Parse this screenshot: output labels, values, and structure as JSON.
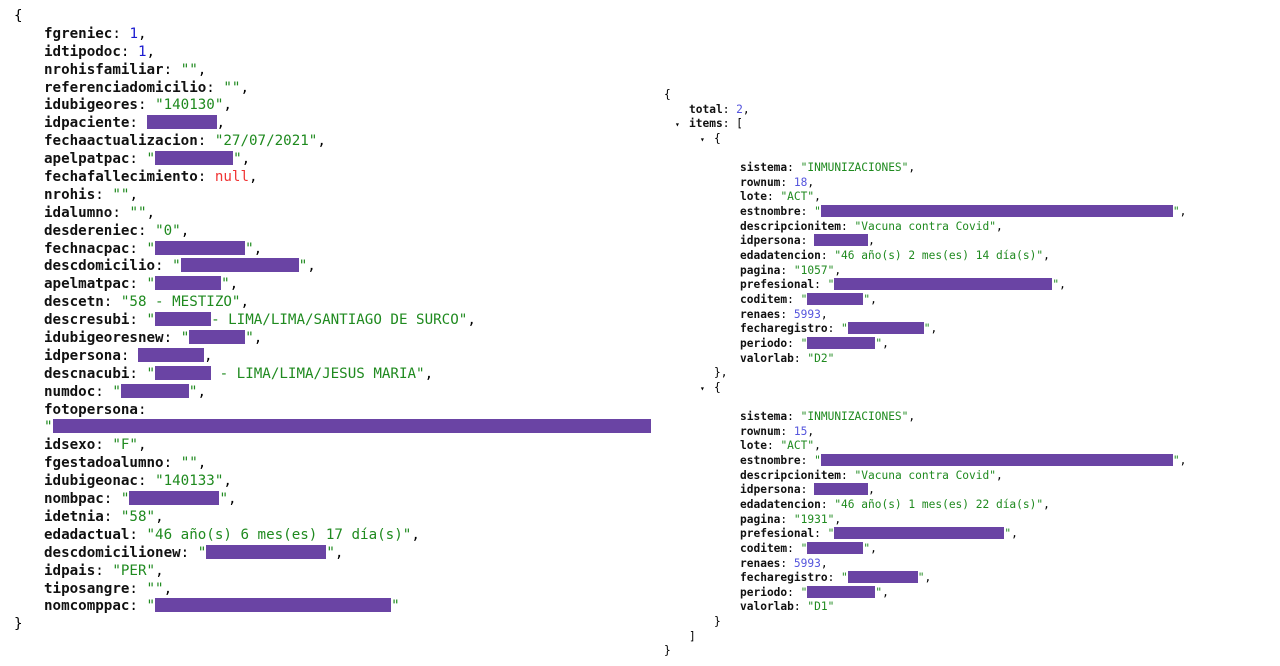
{
  "left": {
    "open": "{",
    "close": "}",
    "fields": [
      {
        "key": "fgreniec",
        "type": "n",
        "value": "1"
      },
      {
        "key": "idtipodoc",
        "type": "n",
        "value": "1"
      },
      {
        "key": "nrohisfamiliar",
        "type": "s",
        "value": "\"\""
      },
      {
        "key": "referenciadomicilio",
        "type": "s",
        "value": "\"\""
      },
      {
        "key": "idubigeores",
        "type": "s",
        "value": "\"140130\""
      },
      {
        "key": "idpaciente",
        "type": "redact"
      },
      {
        "key": "fechaactualizacion",
        "type": "s",
        "value": "\"27/07/2021\""
      },
      {
        "key": "apelpatpac",
        "type": "redact"
      },
      {
        "key": "fechafallecimiento",
        "type": "null",
        "value": "null"
      },
      {
        "key": "nrohis",
        "type": "s",
        "value": "\"\""
      },
      {
        "key": "idalumno",
        "type": "s",
        "value": "\"\""
      },
      {
        "key": "desdereniec",
        "type": "s",
        "value": "\"0\""
      },
      {
        "key": "fechnacpac",
        "type": "redact"
      },
      {
        "key": "descdomicilio",
        "type": "redact"
      },
      {
        "key": "apelmatpac",
        "type": "redact"
      },
      {
        "key": "descetn",
        "type": "s",
        "value": "\"58 - MESTIZO\""
      },
      {
        "key": "descresubi",
        "type": "redact",
        "suffix": "- LIMA/LIMA/SANTIAGO DE SURCO\""
      },
      {
        "key": "idubigeoresnew",
        "type": "redact"
      },
      {
        "key": "idpersona",
        "type": "redact"
      },
      {
        "key": "descnacubi",
        "type": "redact",
        "suffix": " - LIMA/LIMA/JESUS MARIA\""
      },
      {
        "key": "numdoc",
        "type": "redact"
      },
      {
        "key": "fotopersona",
        "type": "redact"
      },
      {
        "key": "idsexo",
        "type": "s",
        "value": "\"F\""
      },
      {
        "key": "fgestadoalumno",
        "type": "s",
        "value": "\"\""
      },
      {
        "key": "idubigeonac",
        "type": "s",
        "value": "\"140133\""
      },
      {
        "key": "nombpac",
        "type": "redact"
      },
      {
        "key": "idetnia",
        "type": "s",
        "value": "\"58\""
      },
      {
        "key": "edadactual",
        "type": "s",
        "value": "\"46 año(s) 6 mes(es) 17 día(s)\""
      },
      {
        "key": "descdomicilionew",
        "type": "redact"
      },
      {
        "key": "idpais",
        "type": "s",
        "value": "\"PER\""
      },
      {
        "key": "tiposangre",
        "type": "s",
        "value": "\"\""
      },
      {
        "key": "nomcomppac",
        "type": "redact"
      }
    ]
  },
  "right": {
    "open": "{",
    "close": "}",
    "total_key": "total",
    "total": "2",
    "items_key": "items",
    "items_open": "[",
    "items_close": "]",
    "item_open": "{",
    "item_close": "},",
    "item_close_last": "}",
    "toggle_glyph": "▾",
    "records": [
      {
        "fields": [
          {
            "key": "sistema",
            "type": "s",
            "value": "\"INMUNIZACIONES\""
          },
          {
            "key": "rownum",
            "type": "n",
            "value": "18"
          },
          {
            "key": "lote",
            "type": "s",
            "value": "\"ACT\""
          },
          {
            "key": "estnombre",
            "type": "redact"
          },
          {
            "key": "descripcionitem",
            "type": "s",
            "value": "\"Vacuna contra Covid\""
          },
          {
            "key": "idpersona",
            "type": "redact"
          },
          {
            "key": "edadatencion",
            "type": "s",
            "value": "\"46 año(s) 2 mes(es) 14 día(s)\""
          },
          {
            "key": "pagina",
            "type": "s",
            "value": "\"1057\""
          },
          {
            "key": "prefesional",
            "type": "redact"
          },
          {
            "key": "coditem",
            "type": "redact"
          },
          {
            "key": "renaes",
            "type": "n",
            "value": "5993"
          },
          {
            "key": "fecharegistro",
            "type": "redact"
          },
          {
            "key": "periodo",
            "type": "redact"
          },
          {
            "key": "valorlab",
            "type": "s",
            "value": "\"D2\""
          }
        ]
      },
      {
        "fields": [
          {
            "key": "sistema",
            "type": "s",
            "value": "\"INMUNIZACIONES\""
          },
          {
            "key": "rownum",
            "type": "n",
            "value": "15"
          },
          {
            "key": "lote",
            "type": "s",
            "value": "\"ACT\""
          },
          {
            "key": "estnombre",
            "type": "redact"
          },
          {
            "key": "descripcionitem",
            "type": "s",
            "value": "\"Vacuna contra Covid\""
          },
          {
            "key": "idpersona",
            "type": "redact"
          },
          {
            "key": "edadatencion",
            "type": "s",
            "value": "\"46 año(s) 1 mes(es) 22 día(s)\""
          },
          {
            "key": "pagina",
            "type": "s",
            "value": "\"1931\""
          },
          {
            "key": "prefesional",
            "type": "redact"
          },
          {
            "key": "coditem",
            "type": "redact"
          },
          {
            "key": "renaes",
            "type": "n",
            "value": "5993"
          },
          {
            "key": "fecharegistro",
            "type": "redact"
          },
          {
            "key": "periodo",
            "type": "redact"
          },
          {
            "key": "valorlab",
            "type": "s",
            "value": "\"D1\""
          }
        ]
      }
    ]
  },
  "colors": {
    "key": "#111111",
    "string": "#1f8a1f",
    "number": "#1a1ad0",
    "null": "#f03434",
    "redaction": "#6a44a4"
  }
}
